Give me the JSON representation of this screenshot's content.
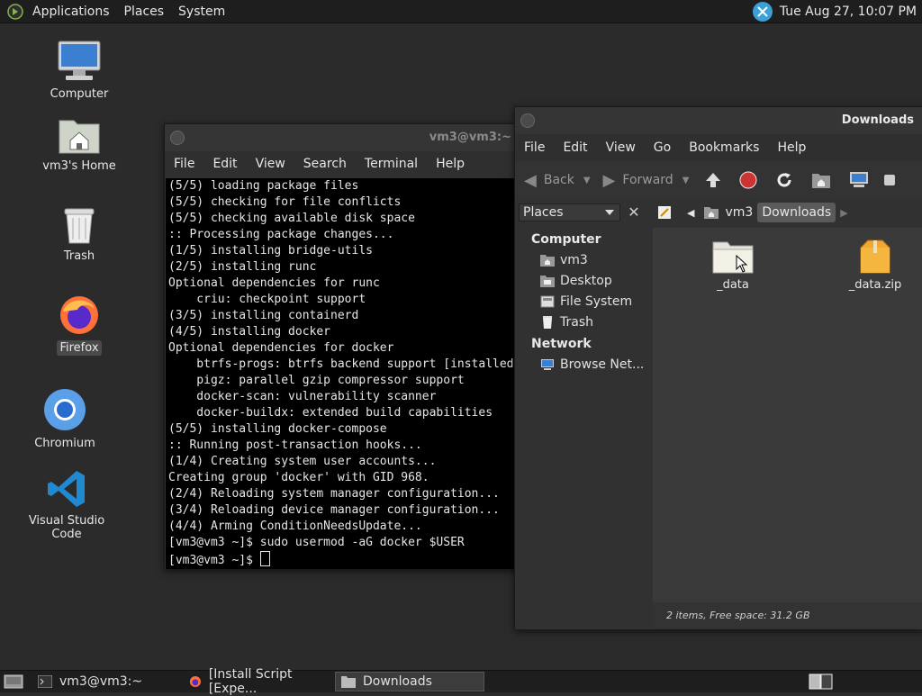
{
  "panel": {
    "menus": [
      "Applications",
      "Places",
      "System"
    ],
    "clock": "Tue Aug 27, 10:07 PM"
  },
  "desktop": {
    "icons": [
      {
        "label": "Computer",
        "icon": "computer-icon"
      },
      {
        "label": "vm3's Home",
        "icon": "home-folder-icon"
      },
      {
        "label": "Trash",
        "icon": "trash-icon"
      },
      {
        "label": "Firefox",
        "icon": "firefox-icon"
      },
      {
        "label": "Chromium",
        "icon": "chromium-icon"
      },
      {
        "label": "Visual Studio Code",
        "icon": "vscode-icon"
      }
    ]
  },
  "terminal": {
    "title": "vm3@vm3:~",
    "menu": [
      "File",
      "Edit",
      "View",
      "Search",
      "Terminal",
      "Help"
    ],
    "lines": [
      "(5/5) loading package files",
      "(5/5) checking for file conflicts",
      "(5/5) checking available disk space",
      ":: Processing package changes...",
      "(1/5) installing bridge-utils",
      "(2/5) installing runc",
      "Optional dependencies for runc",
      "    criu: checkpoint support",
      "(3/5) installing containerd",
      "(4/5) installing docker",
      "Optional dependencies for docker",
      "    btrfs-progs: btrfs backend support [installed]",
      "    pigz: parallel gzip compressor support",
      "    docker-scan: vulnerability scanner",
      "    docker-buildx: extended build capabilities",
      "(5/5) installing docker-compose",
      ":: Running post-transaction hooks...",
      "(1/4) Creating system user accounts...",
      "Creating group 'docker' with GID 968.",
      "(2/4) Reloading system manager configuration...",
      "(3/4) Reloading device manager configuration...",
      "(4/4) Arming ConditionNeedsUpdate...",
      "[vm3@vm3 ~]$ sudo usermod -aG docker $USER",
      "[vm3@vm3 ~]$ "
    ]
  },
  "filemanager": {
    "title": "Downloads",
    "menu": [
      "File",
      "Edit",
      "View",
      "Go",
      "Bookmarks",
      "Help"
    ],
    "toolbar": {
      "back": "Back",
      "forward": "Forward"
    },
    "places_label": "Places",
    "crumbs": [
      "vm3",
      "Downloads"
    ],
    "sidebar": {
      "computer_header": "Computer",
      "computer_items": [
        "vm3",
        "Desktop",
        "File System",
        "Trash"
      ],
      "network_header": "Network",
      "network_items": [
        "Browse Net..."
      ]
    },
    "files": [
      {
        "name": "_data",
        "icon": "folder-icon"
      },
      {
        "name": "_data.zip",
        "icon": "zip-archive-icon"
      }
    ],
    "status": "2 items, Free space: 31.2 GB"
  },
  "taskbar": {
    "tasks": [
      "vm3@vm3:~",
      "[Install Script [Expe...",
      "Downloads"
    ]
  }
}
